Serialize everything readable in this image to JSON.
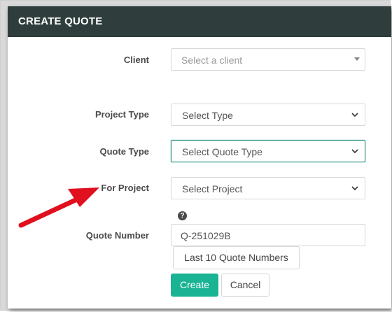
{
  "header": {
    "title": "CREATE QUOTE"
  },
  "form": {
    "client": {
      "label": "Client",
      "placeholder": "Select a client"
    },
    "project_type": {
      "label": "Project Type",
      "value": "Select Type"
    },
    "quote_type": {
      "label": "Quote Type",
      "value": "Select Quote Type"
    },
    "for_project": {
      "label": "For Project",
      "value": "Select Project"
    },
    "quote_number": {
      "label": "Quote Number",
      "value": "Q-251029B",
      "help_icon": "question-circle-icon"
    },
    "last_numbers_button": "Last 10 Quote Numbers"
  },
  "actions": {
    "create": "Create",
    "cancel": "Cancel"
  },
  "colors": {
    "header": "#2f3e3d",
    "accent": "#1ab394",
    "annotation_arrow": "#e0101e"
  }
}
